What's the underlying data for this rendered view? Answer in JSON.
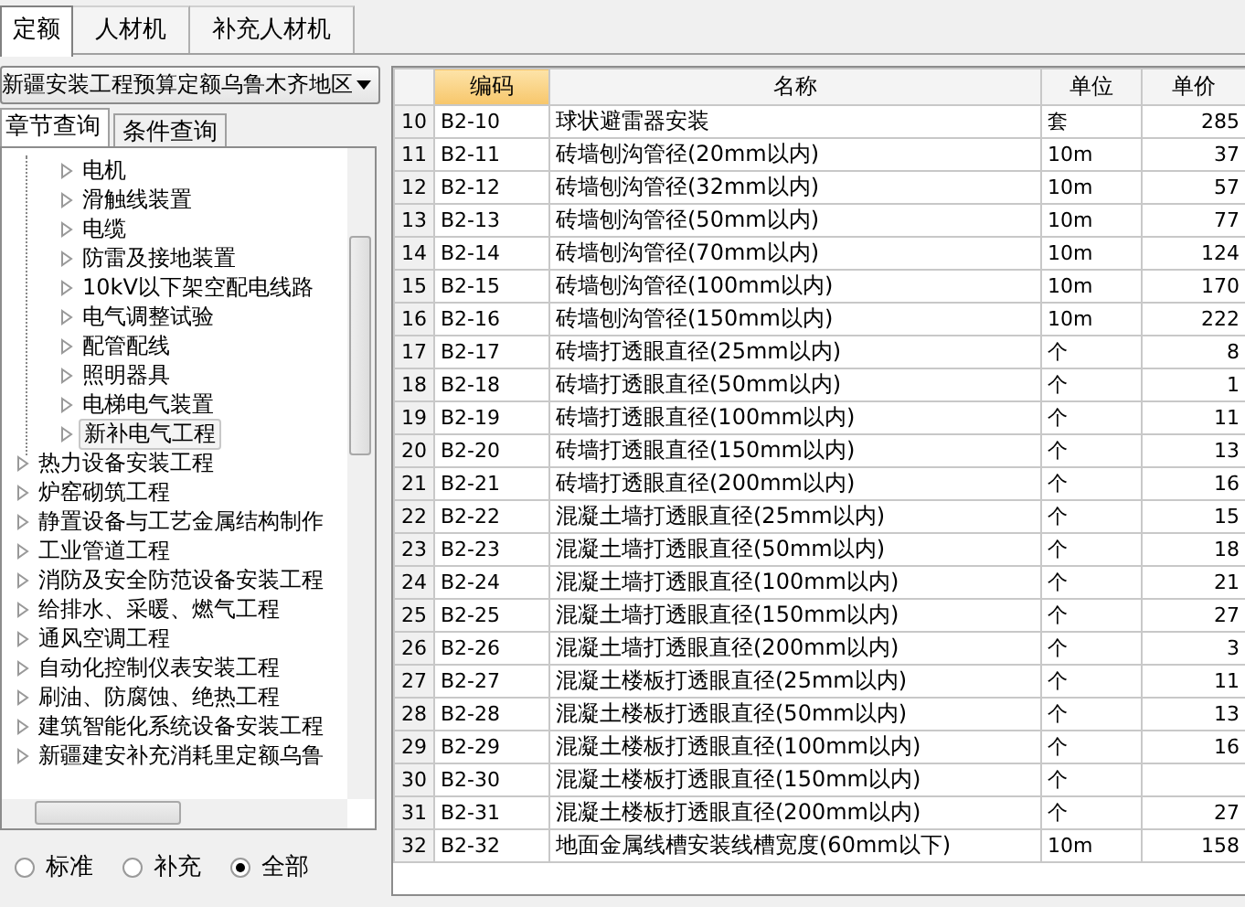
{
  "top_tabs": [
    {
      "label": "定额",
      "selected": true
    },
    {
      "label": "人材机",
      "selected": false
    },
    {
      "label": "补充人材机",
      "selected": false
    }
  ],
  "library_select": {
    "value": "新疆安装工程预算定额乌鲁木齐地区"
  },
  "query_tabs": [
    {
      "label": "章节查询",
      "selected": true
    },
    {
      "label": "条件查询",
      "selected": false
    }
  ],
  "tree": {
    "items": [
      {
        "children": [
          {
            "label": "电机",
            "selected": false
          },
          {
            "label": "滑触线装置",
            "selected": false
          },
          {
            "label": "电缆",
            "selected": false
          },
          {
            "label": "防雷及接地装置",
            "selected": false
          },
          {
            "label": "10kV以下架空配电线路",
            "selected": false
          },
          {
            "label": "电气调整试验",
            "selected": false
          },
          {
            "label": "配管配线",
            "selected": false
          },
          {
            "label": "照明器具",
            "selected": false
          },
          {
            "label": "电梯电气装置",
            "selected": false
          },
          {
            "label": "新补电气工程",
            "selected": true
          }
        ]
      },
      {
        "label": "热力设备安装工程",
        "selected": false
      },
      {
        "label": "炉窑砌筑工程",
        "selected": false
      },
      {
        "label": "静置设备与工艺金属结构制作",
        "selected": false
      },
      {
        "label": "工业管道工程",
        "selected": false
      },
      {
        "label": "消防及安全防范设备安装工程",
        "selected": false
      },
      {
        "label": "给排水、采暖、燃气工程",
        "selected": false
      },
      {
        "label": "通风空调工程",
        "selected": false
      },
      {
        "label": "自动化控制仪表安装工程",
        "selected": false
      },
      {
        "label": "刷油、防腐蚀、绝热工程",
        "selected": false
      },
      {
        "label": "建筑智能化系统设备安装工程",
        "selected": false
      },
      {
        "label": "新疆建安补充消耗里定额乌鲁",
        "selected": false
      }
    ]
  },
  "filter_radios": [
    {
      "label": "标准",
      "selected": false
    },
    {
      "label": "补充",
      "selected": false
    },
    {
      "label": "全部",
      "selected": true
    }
  ],
  "table": {
    "columns": [
      {
        "highlighted": false
      },
      {
        "label": "编码",
        "highlighted": true
      },
      {
        "label": "名称",
        "highlighted": false
      },
      {
        "label": "单位",
        "highlighted": false
      },
      {
        "label": "单价",
        "highlighted": false
      }
    ],
    "rows": [
      [
        "10",
        "B2-10",
        "球状避雷器安装",
        "套",
        "285"
      ],
      [
        "11",
        "B2-11",
        "砖墙刨沟管径(20mm以内)",
        "10m",
        "37"
      ],
      [
        "12",
        "B2-12",
        "砖墙刨沟管径(32mm以内)",
        "10m",
        "57"
      ],
      [
        "13",
        "B2-13",
        "砖墙刨沟管径(50mm以内)",
        "10m",
        "77"
      ],
      [
        "14",
        "B2-14",
        "砖墙刨沟管径(70mm以内)",
        "10m",
        "124"
      ],
      [
        "15",
        "B2-15",
        "砖墙刨沟管径(100mm以内)",
        "10m",
        "170"
      ],
      [
        "16",
        "B2-16",
        "砖墙刨沟管径(150mm以内)",
        "10m",
        "222"
      ],
      [
        "17",
        "B2-17",
        "砖墙打透眼直径(25mm以内)",
        "个",
        "8"
      ],
      [
        "18",
        "B2-18",
        "砖墙打透眼直径(50mm以内)",
        "个",
        "1"
      ],
      [
        "19",
        "B2-19",
        "砖墙打透眼直径(100mm以内)",
        "个",
        "11"
      ],
      [
        "20",
        "B2-20",
        "砖墙打透眼直径(150mm以内)",
        "个",
        "13"
      ],
      [
        "21",
        "B2-21",
        "砖墙打透眼直径(200mm以内)",
        "个",
        "16"
      ],
      [
        "22",
        "B2-22",
        "混凝土墙打透眼直径(25mm以内)",
        "个",
        "15"
      ],
      [
        "23",
        "B2-23",
        "混凝土墙打透眼直径(50mm以内)",
        "个",
        "18"
      ],
      [
        "24",
        "B2-24",
        "混凝土墙打透眼直径(100mm以内)",
        "个",
        "21"
      ],
      [
        "25",
        "B2-25",
        "混凝土墙打透眼直径(150mm以内)",
        "个",
        "27"
      ],
      [
        "26",
        "B2-26",
        "混凝土墙打透眼直径(200mm以内)",
        "个",
        "3"
      ],
      [
        "27",
        "B2-27",
        "混凝土楼板打透眼直径(25mm以内)",
        "个",
        "11"
      ],
      [
        "28",
        "B2-28",
        "混凝土楼板打透眼直径(50mm以内)",
        "个",
        "13"
      ],
      [
        "29",
        "B2-29",
        "混凝土楼板打透眼直径(100mm以内)",
        "个",
        "16"
      ],
      [
        "30",
        "B2-30",
        "混凝土楼板打透眼直径(150mm以内)",
        "个",
        ""
      ],
      [
        "31",
        "B2-31",
        "混凝土楼板打透眼直径(200mm以内)",
        "个",
        "27"
      ],
      [
        "32",
        "B2-32",
        "地面金属线槽安装线槽宽度(60mm以下)",
        "10m",
        "158"
      ]
    ]
  }
}
